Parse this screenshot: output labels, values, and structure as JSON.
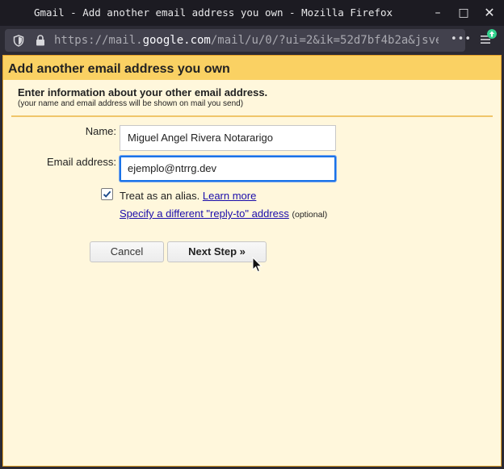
{
  "window": {
    "title": "Gmail - Add another email address you own - Mozilla Firefox",
    "min_symbol": "–",
    "max_symbol": "□",
    "close_symbol": "✕"
  },
  "browser": {
    "url_scheme": "https://mail.",
    "url_host": "google.com",
    "url_path": "/mail/u/0/?ui=2&ik=52d7bf4b2a&jsve",
    "more_symbol": "•••"
  },
  "dialog": {
    "title": "Add another email address you own",
    "intro": "Enter information about your other email address.",
    "subintro": "(your name and email address will be shown on mail you send)",
    "name_label": "Name:",
    "name_value": "Miguel Angel Rivera Notararigo",
    "email_label": "Email address:",
    "email_value": "ejemplo@ntrrg.dev",
    "alias_checked": true,
    "alias_text": "Treat as an alias.",
    "learn_more": "Learn more",
    "reply_to_link": "Specify a different \"reply-to\" address",
    "optional": "(optional)",
    "cancel_label": "Cancel",
    "next_label": "Next Step »"
  },
  "colors": {
    "header_bar": "#fad163",
    "panel_bg": "#fff7dc",
    "link": "#1a0dab",
    "focus": "#1a73e8",
    "browser_chrome": "#2b2a33"
  }
}
